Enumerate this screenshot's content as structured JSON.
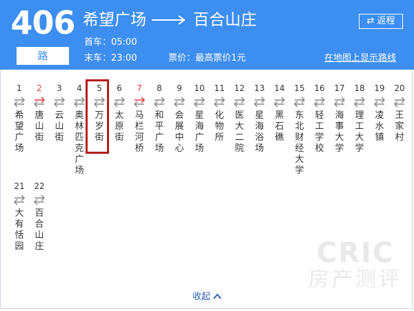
{
  "route": {
    "number": "406",
    "unit": "路",
    "from": "希望广场",
    "to": "百合山庄",
    "first_bus": "首车：05:00",
    "last_bus": "末车：23:00",
    "fare": "票价：最高票价1元",
    "reverse_label": "返程",
    "map_link": "在地图上显示路线"
  },
  "stops": [
    {
      "num": "1",
      "name": "希望广场",
      "num_red": false,
      "arrow_red": false
    },
    {
      "num": "2",
      "name": "唐山街",
      "num_red": true,
      "arrow_red": true
    },
    {
      "num": "3",
      "name": "云山街",
      "num_red": false,
      "arrow_red": false
    },
    {
      "num": "4",
      "name": "奥林匹克广场",
      "num_red": false,
      "arrow_red": false
    },
    {
      "num": "5",
      "name": "万岁街",
      "num_red": false,
      "arrow_red": false
    },
    {
      "num": "6",
      "name": "太原街",
      "num_red": false,
      "arrow_red": false
    },
    {
      "num": "7",
      "name": "马栏河桥",
      "num_red": true,
      "arrow_red": true
    },
    {
      "num": "8",
      "name": "和平广场",
      "num_red": false,
      "arrow_red": false
    },
    {
      "num": "9",
      "name": "会展中心",
      "num_red": false,
      "arrow_red": false
    },
    {
      "num": "10",
      "name": "星海广场",
      "num_red": false,
      "arrow_red": false
    },
    {
      "num": "11",
      "name": "化物所",
      "num_red": false,
      "arrow_red": false
    },
    {
      "num": "12",
      "name": "医大二院",
      "num_red": false,
      "arrow_red": false
    },
    {
      "num": "13",
      "name": "星海浴场",
      "num_red": false,
      "arrow_red": false
    },
    {
      "num": "14",
      "name": "黑石礁",
      "num_red": false,
      "arrow_red": false
    },
    {
      "num": "15",
      "name": "东北财经大学",
      "num_red": false,
      "arrow_red": false
    },
    {
      "num": "16",
      "name": "轻工学校",
      "num_red": false,
      "arrow_red": false
    },
    {
      "num": "17",
      "name": "海事大学",
      "num_red": false,
      "arrow_red": false
    },
    {
      "num": "18",
      "name": "理工大学",
      "num_red": false,
      "arrow_red": false
    },
    {
      "num": "19",
      "name": "凌水镇",
      "num_red": false,
      "arrow_red": false
    },
    {
      "num": "20",
      "name": "王家村",
      "num_red": false,
      "arrow_red": false
    },
    {
      "num": "21",
      "name": "大有恬园",
      "num_red": false,
      "arrow_red": false
    },
    {
      "num": "22",
      "name": "百合山庄",
      "num_red": false,
      "arrow_red": false
    }
  ],
  "highlighted_stop": "5",
  "watermark": {
    "line1": "CRIC",
    "line2": "房产测评"
  },
  "collapse_label": "收起",
  "colors": {
    "header": "#3c8ef0",
    "highlight": "#b71c1c",
    "alert": "#e8353c",
    "link": "#2f5fbf"
  }
}
